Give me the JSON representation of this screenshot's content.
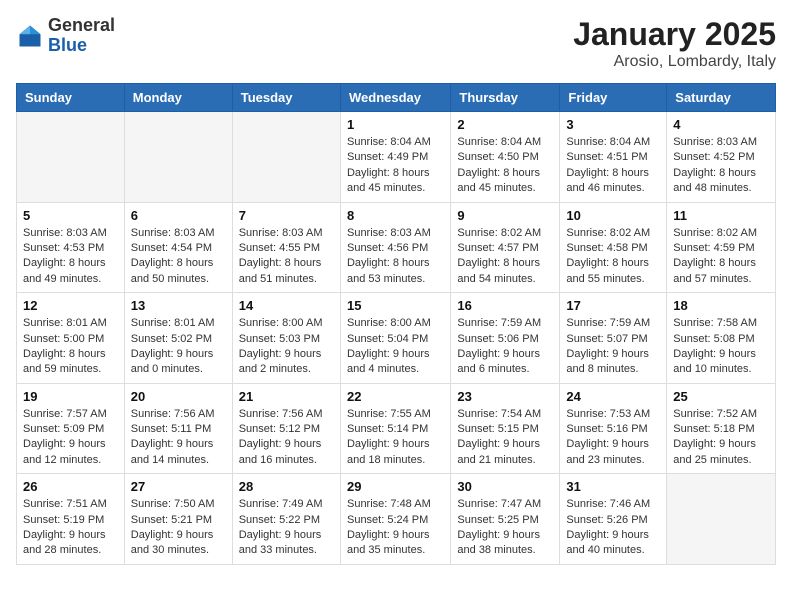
{
  "logo": {
    "general": "General",
    "blue": "Blue"
  },
  "title": "January 2025",
  "location": "Arosio, Lombardy, Italy",
  "headers": [
    "Sunday",
    "Monday",
    "Tuesday",
    "Wednesday",
    "Thursday",
    "Friday",
    "Saturday"
  ],
  "weeks": [
    [
      {
        "day": "",
        "info": ""
      },
      {
        "day": "",
        "info": ""
      },
      {
        "day": "",
        "info": ""
      },
      {
        "day": "1",
        "info": "Sunrise: 8:04 AM\nSunset: 4:49 PM\nDaylight: 8 hours\nand 45 minutes."
      },
      {
        "day": "2",
        "info": "Sunrise: 8:04 AM\nSunset: 4:50 PM\nDaylight: 8 hours\nand 45 minutes."
      },
      {
        "day": "3",
        "info": "Sunrise: 8:04 AM\nSunset: 4:51 PM\nDaylight: 8 hours\nand 46 minutes."
      },
      {
        "day": "4",
        "info": "Sunrise: 8:03 AM\nSunset: 4:52 PM\nDaylight: 8 hours\nand 48 minutes."
      }
    ],
    [
      {
        "day": "5",
        "info": "Sunrise: 8:03 AM\nSunset: 4:53 PM\nDaylight: 8 hours\nand 49 minutes."
      },
      {
        "day": "6",
        "info": "Sunrise: 8:03 AM\nSunset: 4:54 PM\nDaylight: 8 hours\nand 50 minutes."
      },
      {
        "day": "7",
        "info": "Sunrise: 8:03 AM\nSunset: 4:55 PM\nDaylight: 8 hours\nand 51 minutes."
      },
      {
        "day": "8",
        "info": "Sunrise: 8:03 AM\nSunset: 4:56 PM\nDaylight: 8 hours\nand 53 minutes."
      },
      {
        "day": "9",
        "info": "Sunrise: 8:02 AM\nSunset: 4:57 PM\nDaylight: 8 hours\nand 54 minutes."
      },
      {
        "day": "10",
        "info": "Sunrise: 8:02 AM\nSunset: 4:58 PM\nDaylight: 8 hours\nand 55 minutes."
      },
      {
        "day": "11",
        "info": "Sunrise: 8:02 AM\nSunset: 4:59 PM\nDaylight: 8 hours\nand 57 minutes."
      }
    ],
    [
      {
        "day": "12",
        "info": "Sunrise: 8:01 AM\nSunset: 5:00 PM\nDaylight: 8 hours\nand 59 minutes."
      },
      {
        "day": "13",
        "info": "Sunrise: 8:01 AM\nSunset: 5:02 PM\nDaylight: 9 hours\nand 0 minutes."
      },
      {
        "day": "14",
        "info": "Sunrise: 8:00 AM\nSunset: 5:03 PM\nDaylight: 9 hours\nand 2 minutes."
      },
      {
        "day": "15",
        "info": "Sunrise: 8:00 AM\nSunset: 5:04 PM\nDaylight: 9 hours\nand 4 minutes."
      },
      {
        "day": "16",
        "info": "Sunrise: 7:59 AM\nSunset: 5:06 PM\nDaylight: 9 hours\nand 6 minutes."
      },
      {
        "day": "17",
        "info": "Sunrise: 7:59 AM\nSunset: 5:07 PM\nDaylight: 9 hours\nand 8 minutes."
      },
      {
        "day": "18",
        "info": "Sunrise: 7:58 AM\nSunset: 5:08 PM\nDaylight: 9 hours\nand 10 minutes."
      }
    ],
    [
      {
        "day": "19",
        "info": "Sunrise: 7:57 AM\nSunset: 5:09 PM\nDaylight: 9 hours\nand 12 minutes."
      },
      {
        "day": "20",
        "info": "Sunrise: 7:56 AM\nSunset: 5:11 PM\nDaylight: 9 hours\nand 14 minutes."
      },
      {
        "day": "21",
        "info": "Sunrise: 7:56 AM\nSunset: 5:12 PM\nDaylight: 9 hours\nand 16 minutes."
      },
      {
        "day": "22",
        "info": "Sunrise: 7:55 AM\nSunset: 5:14 PM\nDaylight: 9 hours\nand 18 minutes."
      },
      {
        "day": "23",
        "info": "Sunrise: 7:54 AM\nSunset: 5:15 PM\nDaylight: 9 hours\nand 21 minutes."
      },
      {
        "day": "24",
        "info": "Sunrise: 7:53 AM\nSunset: 5:16 PM\nDaylight: 9 hours\nand 23 minutes."
      },
      {
        "day": "25",
        "info": "Sunrise: 7:52 AM\nSunset: 5:18 PM\nDaylight: 9 hours\nand 25 minutes."
      }
    ],
    [
      {
        "day": "26",
        "info": "Sunrise: 7:51 AM\nSunset: 5:19 PM\nDaylight: 9 hours\nand 28 minutes."
      },
      {
        "day": "27",
        "info": "Sunrise: 7:50 AM\nSunset: 5:21 PM\nDaylight: 9 hours\nand 30 minutes."
      },
      {
        "day": "28",
        "info": "Sunrise: 7:49 AM\nSunset: 5:22 PM\nDaylight: 9 hours\nand 33 minutes."
      },
      {
        "day": "29",
        "info": "Sunrise: 7:48 AM\nSunset: 5:24 PM\nDaylight: 9 hours\nand 35 minutes."
      },
      {
        "day": "30",
        "info": "Sunrise: 7:47 AM\nSunset: 5:25 PM\nDaylight: 9 hours\nand 38 minutes."
      },
      {
        "day": "31",
        "info": "Sunrise: 7:46 AM\nSunset: 5:26 PM\nDaylight: 9 hours\nand 40 minutes."
      },
      {
        "day": "",
        "info": ""
      }
    ]
  ]
}
